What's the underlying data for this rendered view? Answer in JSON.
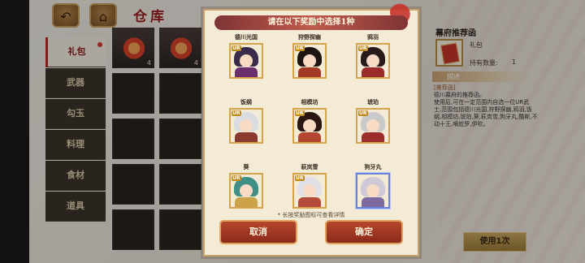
{
  "warehouse": {
    "title": "仓库",
    "back_icon": "back-arrow-icon",
    "home_icon": "home-icon"
  },
  "side_tabs": [
    {
      "label": "礼包",
      "active": true
    },
    {
      "label": "武器",
      "active": false
    },
    {
      "label": "勾玉",
      "active": false
    },
    {
      "label": "料理",
      "active": false
    },
    {
      "label": "食材",
      "active": false
    },
    {
      "label": "道具",
      "active": false
    }
  ],
  "inventory": {
    "slots": [
      {
        "icon": "gift-box-icon",
        "qty": "4"
      },
      {
        "icon": "gift-box-icon",
        "qty": "4"
      }
    ]
  },
  "item_info": {
    "name": "幕府推荐函",
    "category": "礼包",
    "quantity_label": "持有数量:",
    "quantity": "1",
    "section_title": "描述",
    "desc_tag": "[推荐函]",
    "desc_lines": [
      "德川幕府的推荐函。",
      "使用后,可在一定范围内自选一位UR武",
      "士,范围包括德川光国,狩野探幽,鸦羽,饭",
      "纲,相模坊,琥珀,葵,萩岚雪,狗牙丸,酷斯,不",
      "动十王,嘀蛇罗,伊吹。"
    ]
  },
  "use_button": "使用1次",
  "modal": {
    "title": "请在以下奖励中选择1种",
    "characters": [
      {
        "name": "德川光国",
        "badge": "UR",
        "hair": "#3a2b4a",
        "body": "#6b2f6e",
        "selected": false
      },
      {
        "name": "狩野探幽",
        "badge": "UR",
        "hair": "#1e1412",
        "body": "#a33a26",
        "selected": false
      },
      {
        "name": "鸦羽",
        "badge": "UR",
        "hair": "#2a1b1b",
        "body": "#9c2b2b",
        "selected": false
      },
      {
        "name": "饭纲",
        "badge": "UR",
        "hair": "#d9dde2",
        "body": "#8a3a2f",
        "selected": false
      },
      {
        "name": "相模坊",
        "badge": "UR",
        "hair": "#2a1712",
        "body": "#b2472f",
        "selected": false
      },
      {
        "name": "琥珀",
        "badge": "UR",
        "hair": "#c9c9c9",
        "body": "#9b2d2d",
        "selected": false
      },
      {
        "name": "葵",
        "badge": "UR",
        "hair": "#3f8f86",
        "body": "#c9a24a",
        "selected": false
      },
      {
        "name": "萩岚雪",
        "badge": "UR",
        "hair": "#e0e0e6",
        "body": "#b34a3a",
        "selected": false
      },
      {
        "name": "狗牙丸",
        "badge": "",
        "hair": "#cfc8d6",
        "body": "#7c6aa0",
        "selected": true
      }
    ],
    "hint": "* 长按奖励图标可查看详情",
    "cancel": "取消",
    "confirm": "确定"
  }
}
